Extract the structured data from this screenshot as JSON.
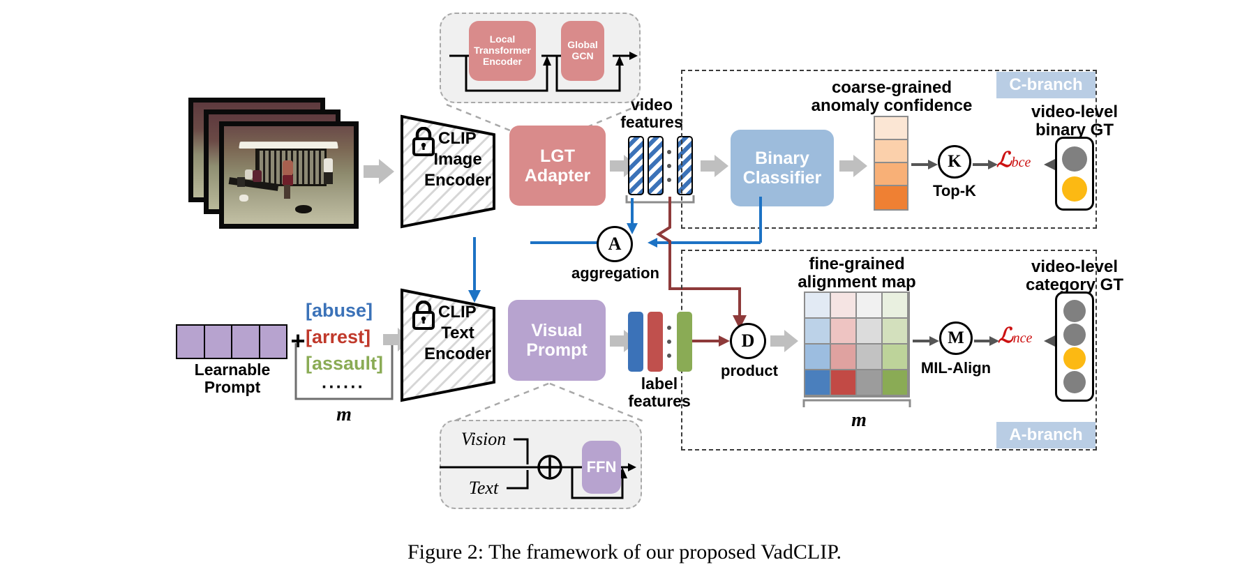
{
  "figure": {
    "caption": "Figure 2: The framework of our proposed VadCLIP."
  },
  "lgt_detail": {
    "local_block": "Local\nTransformer\nEncoder",
    "local_lines": [
      "Local",
      "Transformer",
      "Encoder"
    ],
    "global_lines": [
      "Global",
      "GCN"
    ]
  },
  "vp_detail": {
    "vision_label": "Vision",
    "text_label": "Text",
    "op_symbol": "⊕",
    "ffn_label": "FFN"
  },
  "visual_pipeline": {
    "image_encoder_lines": [
      "CLIP",
      "Image",
      "Encoder"
    ],
    "lock_icon": "lock-icon",
    "lgt_adapter_lines": [
      "LGT",
      "Adapter"
    ],
    "video_features_label": "video\nfeatures",
    "video_features_lines": [
      "video",
      "features"
    ]
  },
  "text_pipeline": {
    "learnable_prompt_lines": [
      "Learnable",
      "Prompt"
    ],
    "prompt_cells": 4,
    "plus_symbol": "+",
    "class_words": [
      {
        "text": "[abuse]",
        "color": "#3b72b8"
      },
      {
        "text": "[arrest]",
        "color": "#c0392b"
      },
      {
        "text": "[assault]",
        "color": "#8aab55"
      }
    ],
    "ellipsis": "······",
    "count_label": "m",
    "text_encoder_lines": [
      "CLIP",
      "Text",
      "Encoder"
    ],
    "visual_prompt_lines": [
      "Visual",
      "Prompt"
    ],
    "label_features_lines": [
      "label",
      "features"
    ],
    "label_feature_colors": [
      "#3b72b8",
      "#c0504d",
      "#8aab55"
    ]
  },
  "aggregation": {
    "symbol": "A",
    "label": "aggregation"
  },
  "product": {
    "symbol": "D",
    "label": "product"
  },
  "c_branch": {
    "tag": "C-branch",
    "classifier_lines": [
      "Binary",
      "Classifier"
    ],
    "confidence_title_lines": [
      "coarse-grained",
      "anomaly confidence"
    ],
    "topk": {
      "symbol": "K",
      "label": "Top-K"
    },
    "loss": {
      "symbol": "ℒ",
      "subscript": "bce"
    },
    "gt_title_lines": [
      "video-level",
      "binary GT"
    ],
    "gt_dots": [
      {
        "color": "#808080"
      },
      {
        "color": "#fcb913"
      }
    ]
  },
  "a_branch": {
    "tag": "A-branch",
    "map_title_lines": [
      "fine-grained",
      "alignment map"
    ],
    "milalign": {
      "symbol": "M",
      "label": "MIL-Align"
    },
    "loss": {
      "symbol": "ℒ",
      "subscript": "nce"
    },
    "gt_title_lines": [
      "video-level",
      "category GT"
    ],
    "gt_dots": [
      {
        "color": "#808080"
      },
      {
        "color": "#808080"
      },
      {
        "color": "#fcb913"
      },
      {
        "color": "#808080"
      }
    ],
    "width_label": "m"
  },
  "chart_data": {
    "type": "heatmap",
    "title": "fine-grained alignment map",
    "rows": 4,
    "cols": 4,
    "col_hues": [
      "#4a7fbd",
      "#c0504d",
      "#9c9c9c",
      "#8aab55"
    ],
    "row_alphas": [
      0.14,
      0.36,
      0.62,
      1.0
    ],
    "xlabel": "m",
    "ylabel": "",
    "grid": true
  },
  "confidence_chart": {
    "type": "heatmap",
    "title": "coarse-grained anomaly confidence",
    "cells": [
      "#fbe6d4",
      "#fbd0ab",
      "#f8b077",
      "#ef8033"
    ],
    "values": [
      0.15,
      0.4,
      0.65,
      0.9
    ]
  }
}
